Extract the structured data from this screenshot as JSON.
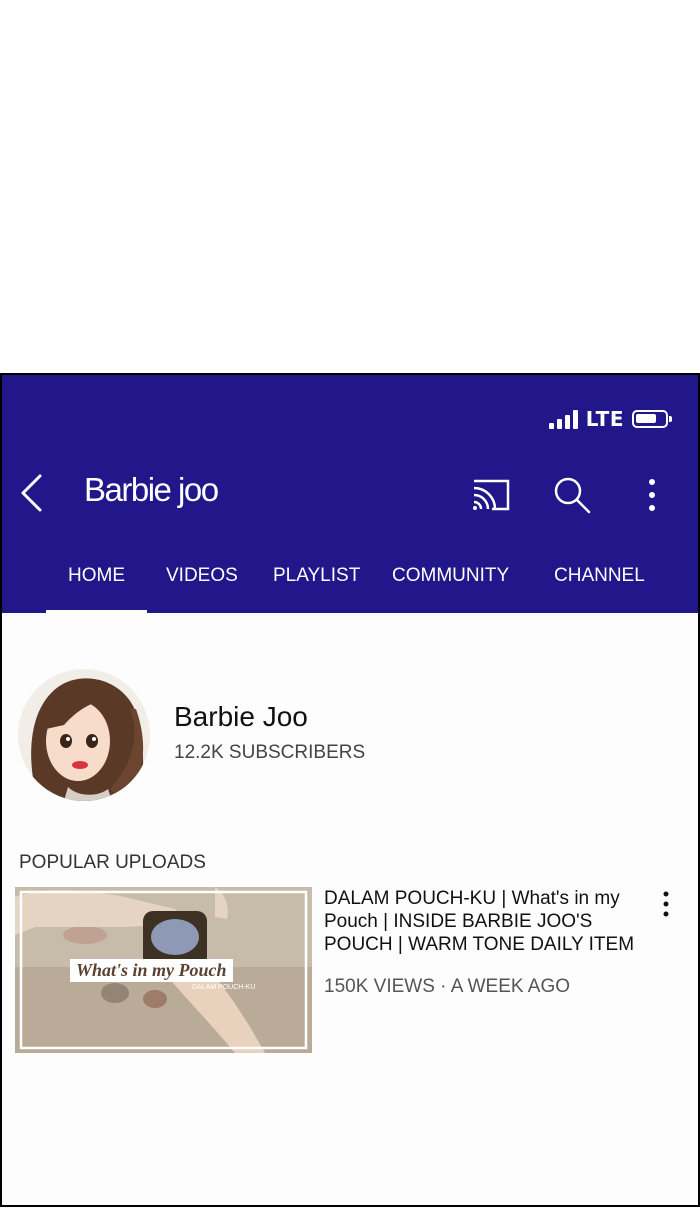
{
  "status_bar": {
    "network": "LTE",
    "icons": [
      "signal-icon",
      "battery-icon"
    ]
  },
  "app_bar": {
    "title": "Barbie joo",
    "icons": [
      "back-icon",
      "cast-icon",
      "search-icon",
      "more-vert-icon"
    ],
    "background": "#21168a"
  },
  "tabs": [
    {
      "label": "HOME",
      "selected": true
    },
    {
      "label": "VIDEOS",
      "selected": false
    },
    {
      "label": "PLAYLIST",
      "selected": false
    },
    {
      "label": "COMMUNITY",
      "selected": false
    },
    {
      "label": "CHANNEL",
      "selected": false
    }
  ],
  "channel": {
    "name": "Barbie Joo",
    "subscribers": "12.2K SUBSCRIBERS"
  },
  "popular_uploads": {
    "heading": "POPULAR UPLOADS",
    "videos": [
      {
        "title": "DALAM POUCH-KU | What's in my Pouch | INSIDE BARBIE JOO'S POUCH | WARM TONE DAILY ITEM",
        "meta": "150K VIEWS · A WEEK AGO",
        "thumbnail_text": "What's in my Pouch",
        "thumbnail_subtext": "DALAM POUCH-KU"
      }
    ]
  }
}
